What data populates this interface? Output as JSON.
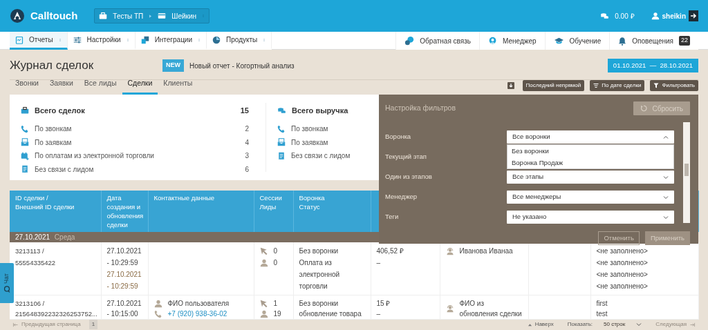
{
  "app": {
    "logo": "Calltouch",
    "breadcrumb": [
      "Тесты ТП",
      "Шейкин"
    ],
    "balance": "0.00 ₽",
    "user": "sheikin"
  },
  "nav_left": [
    {
      "label": "Отчеты",
      "selected": true
    },
    {
      "label": "Настройки",
      "selected": false
    },
    {
      "label": "Интеграции",
      "selected": false
    },
    {
      "label": "Продукты",
      "selected": false
    }
  ],
  "nav_right": [
    {
      "label": "Обратная связь"
    },
    {
      "label": "Менеджер"
    },
    {
      "label": "Обучение"
    },
    {
      "label": "Оповещения",
      "badge": "22"
    }
  ],
  "page": {
    "title": "Журнал сделок",
    "new_badge": "NEW",
    "new_link": "Новый отчет - Когортный анализ",
    "date_range": "01.10.2021  —  28.10.2021"
  },
  "tabs": [
    {
      "label": "Звонки",
      "selected": false
    },
    {
      "label": "Заявки",
      "selected": false
    },
    {
      "label": "Все лиды",
      "selected": false
    },
    {
      "label": "Сделки",
      "selected": true
    },
    {
      "label": "Клиенты",
      "selected": false
    }
  ],
  "toolbar": {
    "attribution": "Последний непрямой",
    "sort": "По дате сделки",
    "filter": "Фильтровать"
  },
  "stats": [
    {
      "title": "Всего сделок",
      "total": "15",
      "rows": [
        {
          "kind": "calls",
          "label": "По звонкам",
          "value": "2"
        },
        {
          "kind": "forms",
          "label": "По заявкам",
          "value": "4"
        },
        {
          "kind": "ecommerce",
          "label": "По оплатам из электронной торговли",
          "value": "3"
        },
        {
          "kind": "unlinked",
          "label": "Без связи с лидом",
          "value": "6"
        }
      ]
    },
    {
      "title": "Всего выручка",
      "rows": [
        {
          "kind": "calls",
          "label": "По звонкам"
        },
        {
          "kind": "forms",
          "label": "По заявкам"
        },
        {
          "kind": "unlinked",
          "label": "Без связи с лидом"
        }
      ]
    }
  ],
  "table": {
    "columns": [
      {
        "lines": [
          "ID сделки /",
          "Внешний ID сделки"
        ]
      },
      {
        "lines": [
          "Дата",
          "создания и",
          "обновления",
          "сделки"
        ]
      },
      {
        "lines": [
          "Контактные данные"
        ]
      },
      {
        "lines": [
          "Сессии",
          "Лиды"
        ]
      },
      {
        "lines": [
          "Воронка",
          "Статус"
        ]
      }
    ],
    "group": {
      "date": "27.10.2021",
      "weekday": "Среда"
    },
    "rows": [
      {
        "deal_id": [
          "3213113 /",
          "55554335422"
        ],
        "dates": [
          "27.10.2021 - 10:29:59",
          "27.10.2021 - 10:29:59"
        ],
        "sessions": "0",
        "leads": "0",
        "funnel": "Без воронки",
        "status": "Оплата из электронной торговли",
        "revenue": "406,52 ₽",
        "column_6_line_2": "–",
        "manager": "Иванова Иванаа",
        "column_9": [
          "<не заполнено>",
          "<не заполнено>",
          "<не заполнено>",
          "<не заполнено>"
        ]
      },
      {
        "deal_id": [
          "3213106 /",
          "215648392232326253752..."
        ],
        "dates": [
          "27.10.2021 - 10:15:00"
        ],
        "contact": {
          "name": "ФИО пользователя",
          "phone": "+7 (920) 938-36-02"
        },
        "sessions": "1",
        "leads": "19",
        "funnel": "Без воронки",
        "status": "обновление товара",
        "revenue": "15 ₽",
        "column_6_line_2": "–",
        "manager": "ФИО из обновления сделки",
        "column_9": [
          "first",
          "test"
        ]
      }
    ]
  },
  "filter_panel": {
    "title": "Настройка фильтров",
    "reset": "Сбросить",
    "fields": [
      {
        "label": "Воронка",
        "value": "Все воронки",
        "expanded": true,
        "options": [
          "Без воронки",
          "Воронка Продаж"
        ]
      },
      {
        "label": "Текущий этап",
        "expanded": false
      },
      {
        "label": "Один из этапов",
        "value": "Все этапы",
        "expanded": false
      },
      {
        "label": "Менеджер",
        "value": "Все менеджеры",
        "expanded": false
      },
      {
        "label": "Теги",
        "value": "Не указано",
        "expanded": false
      }
    ],
    "cancel": "Отменить",
    "apply": "Применить"
  },
  "chat_tab": "Чат",
  "pagination": {
    "prev": "Предыдущая страница",
    "prev_disabled": true,
    "page": "1",
    "top": "Наверх",
    "show_label": "Показать:",
    "rows_option": "50 строк",
    "next": "Следующая",
    "next_disabled": true
  }
}
